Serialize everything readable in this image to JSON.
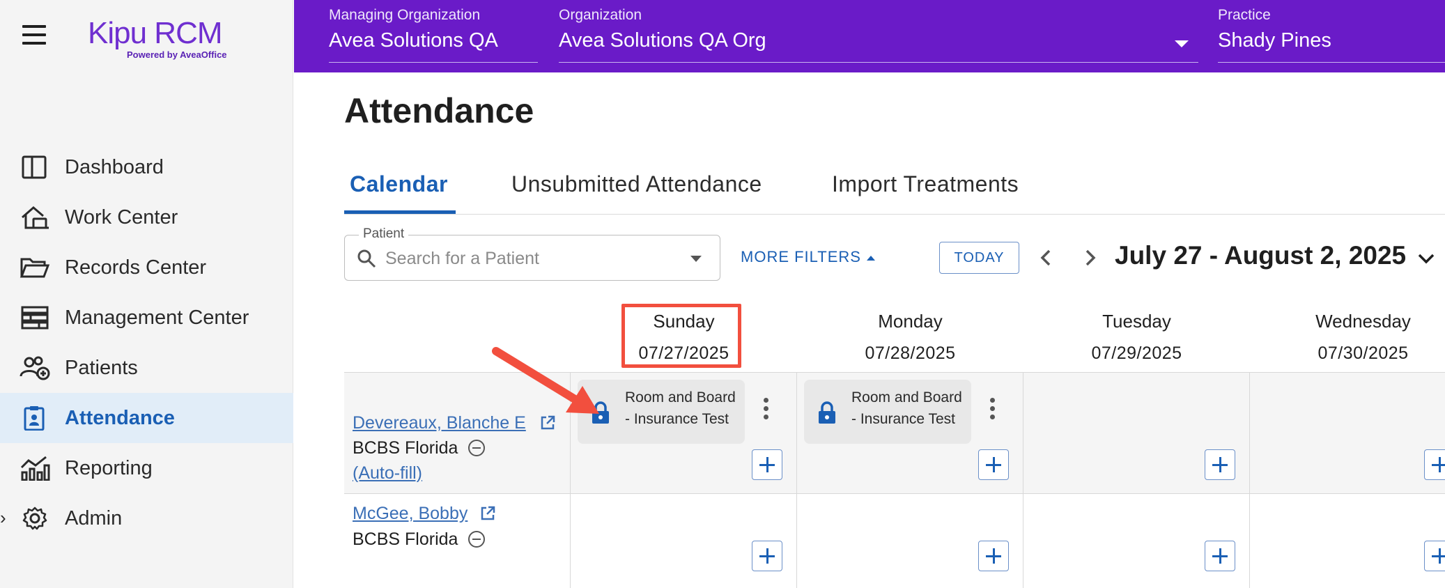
{
  "brand": {
    "name": "Kipu RCM",
    "tagline": "Powered by AveaOffice",
    "accent": "#6a1bc8",
    "link_color": "#1a5fb4"
  },
  "sidebar": {
    "items": [
      {
        "label": "Dashboard",
        "icon": "dashboard-icon"
      },
      {
        "label": "Work Center",
        "icon": "work-center-icon"
      },
      {
        "label": "Records Center",
        "icon": "folder-icon"
      },
      {
        "label": "Management Center",
        "icon": "management-icon"
      },
      {
        "label": "Patients",
        "icon": "patients-icon"
      },
      {
        "label": "Attendance",
        "icon": "clipboard-icon",
        "active": true
      },
      {
        "label": "Reporting",
        "icon": "reporting-icon"
      },
      {
        "label": "Admin",
        "icon": "gear-icon"
      }
    ]
  },
  "header": {
    "managing_org_label": "Managing Organization",
    "managing_org_value": "Avea Solutions QA",
    "org_label": "Organization",
    "org_value": "Avea Solutions QA Org",
    "practice_label": "Practice",
    "practice_value": "Shady Pines"
  },
  "page": {
    "title": "Attendance",
    "tabs": [
      {
        "label": "Calendar",
        "active": true
      },
      {
        "label": "Unsubmitted Attendance"
      },
      {
        "label": "Import Treatments"
      }
    ]
  },
  "filters": {
    "patient_label": "Patient",
    "patient_placeholder": "Search for a Patient",
    "more_filters": "MORE FILTERS",
    "today": "TODAY",
    "date_range": "July 27 - August 2, 2025"
  },
  "calendar": {
    "days": [
      {
        "name": "Sunday",
        "date": "07/27/2025"
      },
      {
        "name": "Monday",
        "date": "07/28/2025"
      },
      {
        "name": "Tuesday",
        "date": "07/29/2025"
      },
      {
        "name": "Wednesday",
        "date": "07/30/2025"
      }
    ],
    "rows": [
      {
        "patient": "Devereaux, Blanche E",
        "payer": "BCBS Florida",
        "autofill": "(Auto-fill)",
        "events": [
          {
            "day": "Sunday",
            "text": "Room and Board - Insurance Test",
            "locked": true
          },
          {
            "day": "Monday",
            "text": "Room and Board - Insurance Test",
            "locked": true
          }
        ]
      },
      {
        "patient": "McGee, Bobby",
        "payer": "BCBS Florida",
        "events": []
      }
    ]
  },
  "annotation": {
    "highlight_color": "#f24f3e"
  }
}
